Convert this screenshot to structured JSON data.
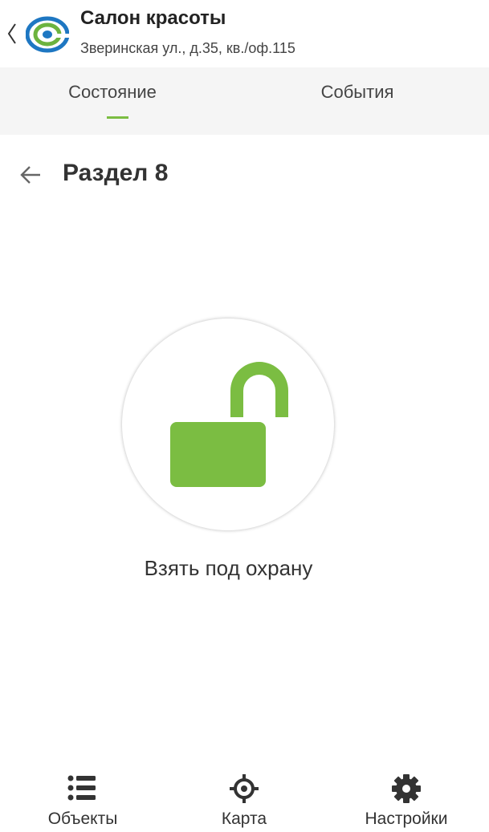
{
  "header": {
    "title": "Салон красоты",
    "subtitle": "Зверинская ул., д.35, кв./оф.115",
    "back_icon": "chevron-left-icon",
    "logo_icon": "app-logo-icon"
  },
  "tabs": [
    {
      "label": "Состояние",
      "selected": true
    },
    {
      "label": "События",
      "selected": false
    }
  ],
  "section": {
    "title": "Раздел 8",
    "back_icon": "arrow-left-icon"
  },
  "arm_control": {
    "status_icon": "unlocked-padlock-icon",
    "label": "Взять под охрану"
  },
  "bottom_nav": [
    {
      "label": "Объекты",
      "icon": "list-icon"
    },
    {
      "label": "Карта",
      "icon": "crosshair-icon"
    },
    {
      "label": "Настройки",
      "icon": "gear-icon"
    }
  ],
  "colors": {
    "accent": "#7bbd42",
    "tabs_background": "#f5f5f5",
    "text": "#333333",
    "logo_blue": "#1e77c2",
    "logo_green": "#6cb33f"
  }
}
